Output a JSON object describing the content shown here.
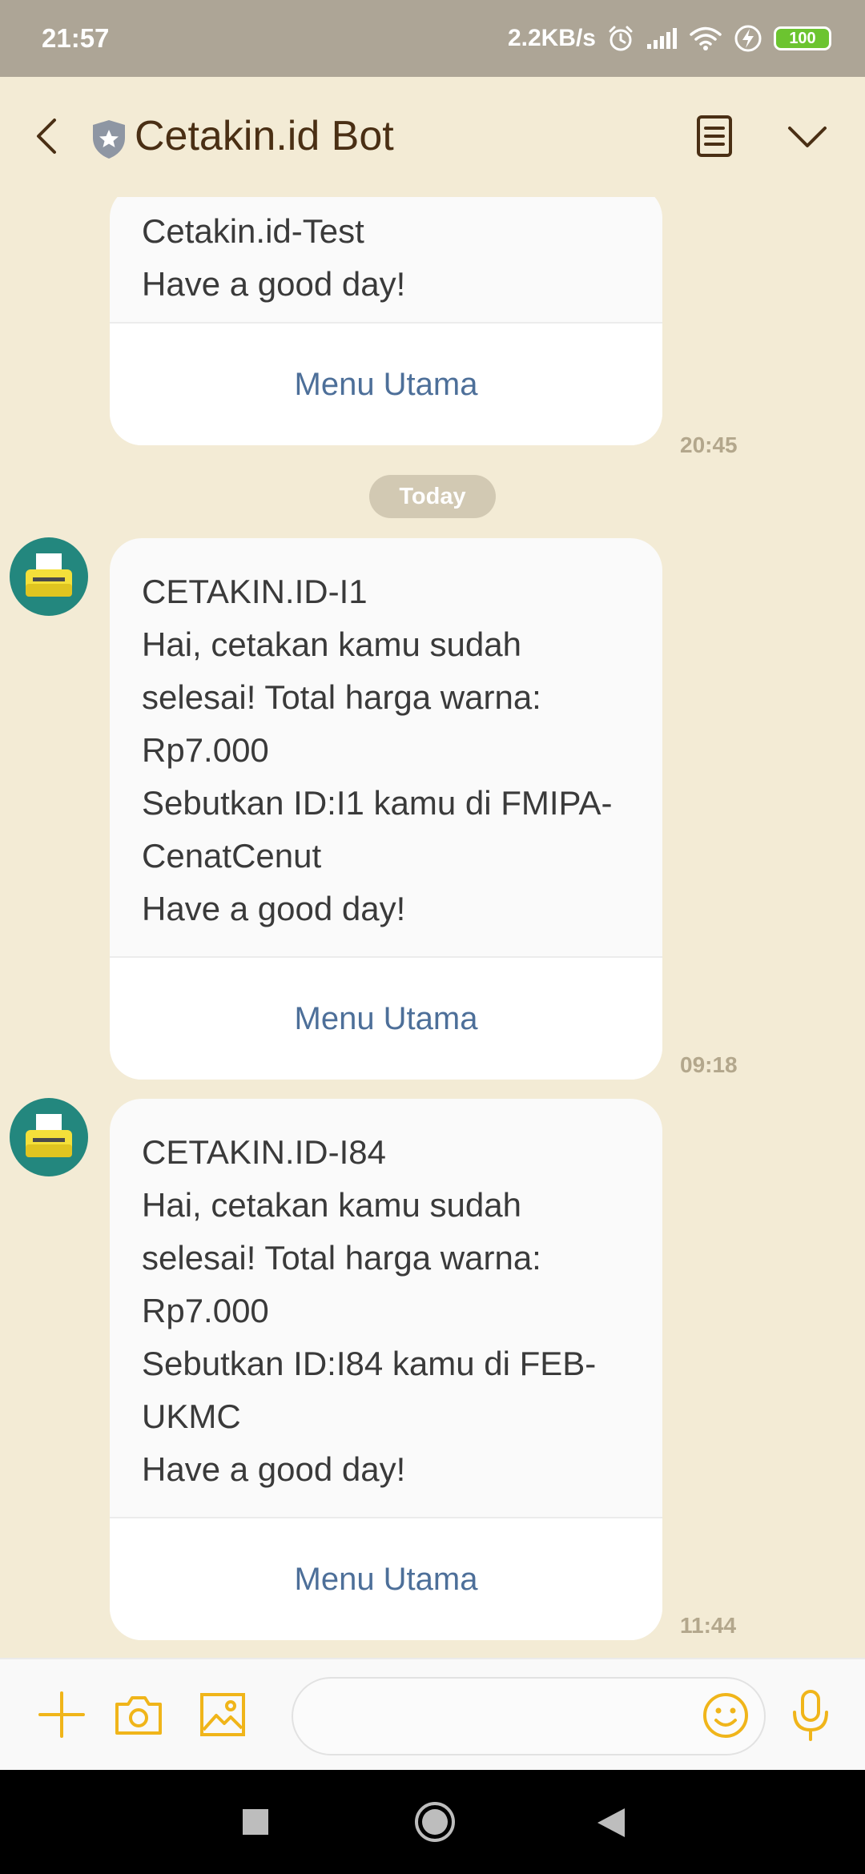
{
  "status_bar": {
    "time": "21:57",
    "speed": "2.2KB/s",
    "battery": "100",
    "icons": [
      "alarm-icon",
      "signal-icon",
      "wifi-icon",
      "charging-icon",
      "battery-icon"
    ]
  },
  "header": {
    "title": "Cetakin.id Bot",
    "icons": [
      "back-arrow-icon",
      "verified-shield-icon",
      "notes-icon",
      "chevron-down-icon"
    ]
  },
  "messages": [
    {
      "lines": [
        "Cetakin.id-Test",
        "Have a good day!"
      ],
      "button": "Menu Utama",
      "time": "20:45"
    },
    {
      "lines": [
        "CETAKIN.ID-I1",
        "Hai, cetakan kamu sudah",
        "selesai! Total harga warna:",
        "Rp7.000",
        "Sebutkan ID:I1 kamu di FMIPA-",
        "CenatCenut",
        "Have a good day!"
      ],
      "button": "Menu Utama",
      "time": "09:18"
    },
    {
      "lines": [
        "CETAKIN.ID-I84",
        "Hai, cetakan kamu sudah",
        "selesai! Total harga warna:",
        "Rp7.000",
        "Sebutkan ID:I84 kamu di FEB-",
        "UKMC",
        "Have a good day!"
      ],
      "button": "Menu Utama",
      "time": "11:44"
    }
  ],
  "date_separator": "Today",
  "input": {
    "value": "",
    "icons": [
      "plus-icon",
      "camera-icon",
      "image-icon",
      "emoji-icon",
      "microphone-icon"
    ]
  },
  "colors": {
    "background": "#f3ebd5",
    "status_bar": "#ada596",
    "accent": "#f0b51a",
    "avatar": "#23877e",
    "link": "#4d6f99"
  }
}
